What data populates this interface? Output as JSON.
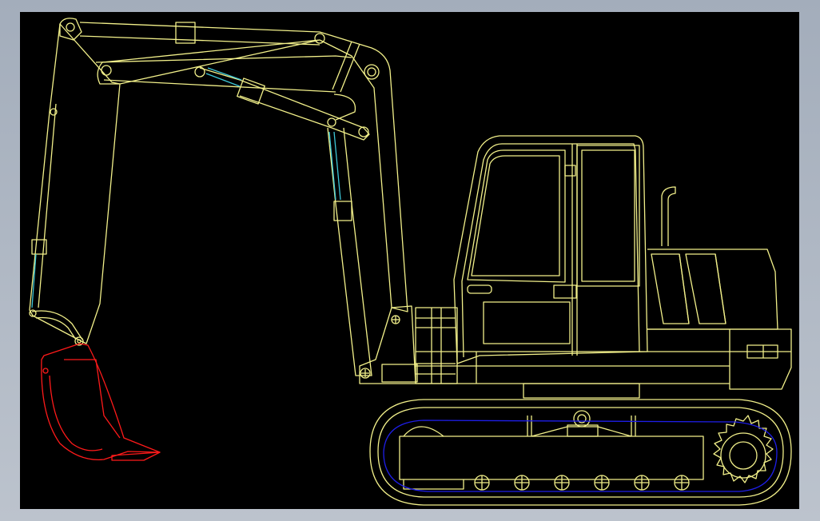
{
  "colors": {
    "frame": "#a3adbb",
    "background": "#000000",
    "linework": "#f2f08a",
    "hydraulic": "#3ec8d8",
    "bucket": "#ff1a1a",
    "track_chain": "#1e1ee8"
  },
  "drawing": {
    "subject": "excavator-side-elevation",
    "layers": [
      "linework",
      "hydraulic",
      "bucket",
      "track_chain"
    ]
  }
}
